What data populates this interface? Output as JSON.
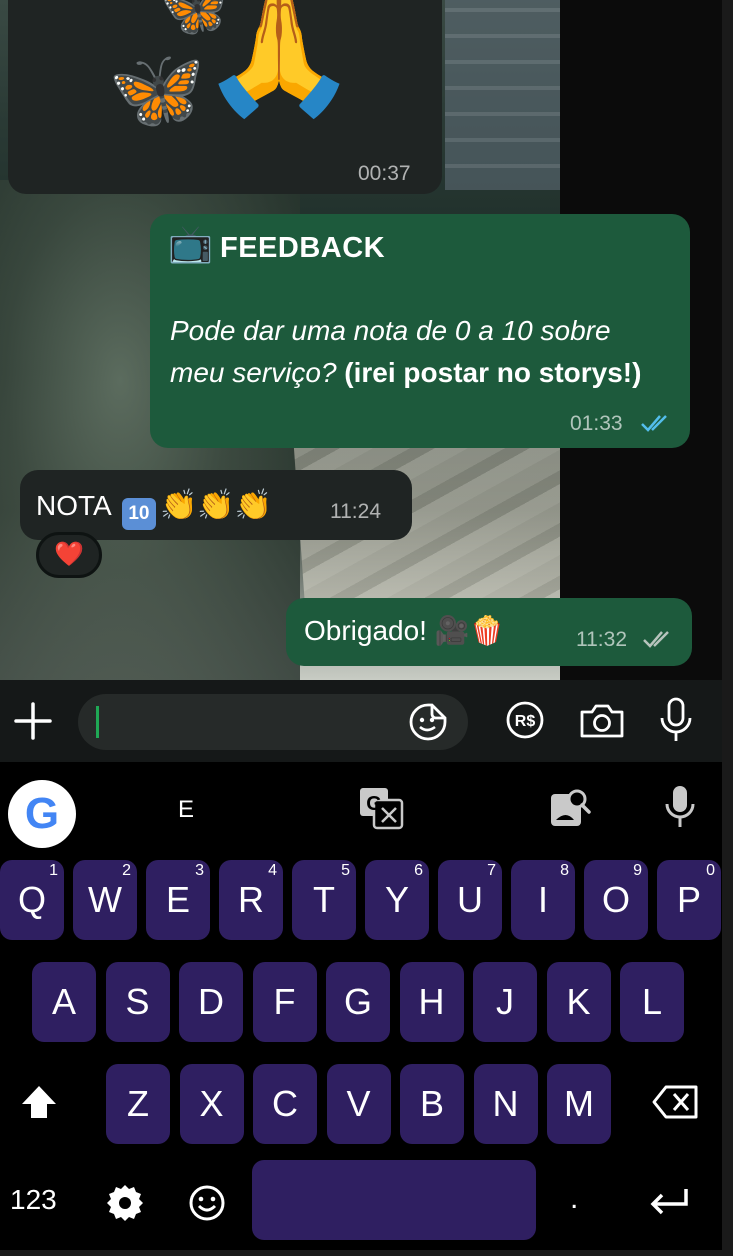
{
  "messages": {
    "image": {
      "time": "00:37",
      "emojis": [
        "🦋",
        "🦋",
        "🙏"
      ]
    },
    "feedback": {
      "icon": "📺",
      "title": "FEEDBACK",
      "body_italic": "Pode dar uma nota de 0 a 10 sobre meu serviço?",
      "body_bold": "(irei postar no storys!)",
      "time": "01:33",
      "status": "read"
    },
    "nota": {
      "text": "NOTA",
      "ten": "10",
      "claps": "👏👏👏",
      "time": "11:24",
      "reaction": "❤️"
    },
    "obrigado": {
      "text": "Obrigado!",
      "emojis": "🎥🍿",
      "time": "11:32",
      "status": "delivered"
    }
  },
  "input_bar": {
    "icons": [
      "plus-icon",
      "sticker-icon",
      "payment-icon",
      "camera-icon",
      "microphone-icon"
    ],
    "payment_label": "R$"
  },
  "keyboard": {
    "suggestion": "E",
    "row1": [
      {
        "k": "Q",
        "n": "1"
      },
      {
        "k": "W",
        "n": "2"
      },
      {
        "k": "E",
        "n": "3"
      },
      {
        "k": "R",
        "n": "4"
      },
      {
        "k": "T",
        "n": "5"
      },
      {
        "k": "Y",
        "n": "6"
      },
      {
        "k": "U",
        "n": "7"
      },
      {
        "k": "I",
        "n": "8"
      },
      {
        "k": "O",
        "n": "9"
      },
      {
        "k": "P",
        "n": "0"
      }
    ],
    "row2": [
      "A",
      "S",
      "D",
      "F",
      "G",
      "H",
      "J",
      "K",
      "L"
    ],
    "row3": [
      "Z",
      "X",
      "C",
      "V",
      "B",
      "N",
      "M"
    ],
    "numbers_label": "123",
    "period": ".",
    "colors": {
      "key": "#2f1f61",
      "outgoing": "#1d5a3c",
      "incoming": "#1f2423",
      "read_ticks": "#53bdeb"
    }
  }
}
